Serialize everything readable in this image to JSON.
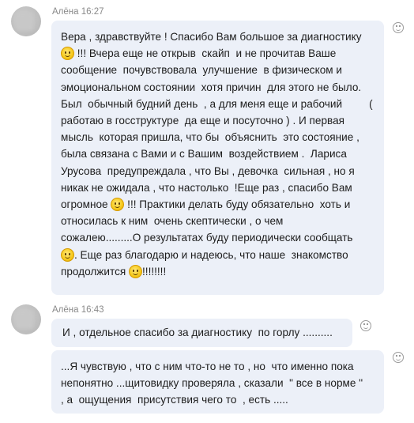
{
  "messages": [
    {
      "author": "Алёна",
      "time": "16:27",
      "text": [
        "Вера , здравствуйте ! Спасибо Вам большое за диагностику",
        " !!! Вчера еще не открыв  скайп  и не прочитав Ваше",
        "сообщение  почувствовала  улучшение  в физическом и",
        "эмоциональном состоянии  хотя причин  для этого не было.",
        "Был  обычный будний день  , а для меня еще и рабочий         (",
        "работаю в госструктуре  да еще и посуточно ) . И первая",
        "мысль  которая пришла, что бы  объяснить  это состояние ,",
        "была связана с Вами и с Вашим  воздействием .  Лариса",
        "Урусова  предупреждала , что Вы , девочка  сильная , но я",
        "никак не ожидала , что настолько  !Еще раз , спасибо Вам",
        "огромное ",
        " !!! Практики делать буду обязательно  хоть и",
        "относилась к ним  очень скептически , о чем",
        "сожалею.........О результатах буду периодически сообщать",
        ". Еще раз благодарю и надеюсь, что наше  знакомство",
        "продолжится ",
        "!!!!!!!!"
      ]
    },
    {
      "author": "Алёна",
      "time": "16:43",
      "text": [
        "И , отдельное спасибо за диагностику  по горлу .........."
      ]
    },
    {
      "text": [
        "...Я чувствую , что с ним что-то не то , но  что именно пока",
        "непонятно ...щитовидку проверяла , сказали  \" все в норме \"",
        ", а  ощущения  присутствия чего то  , есть ....."
      ]
    }
  ],
  "icons": {
    "reaction": "smiley-reaction-icon",
    "emoji": "smiley-emoji-icon"
  }
}
